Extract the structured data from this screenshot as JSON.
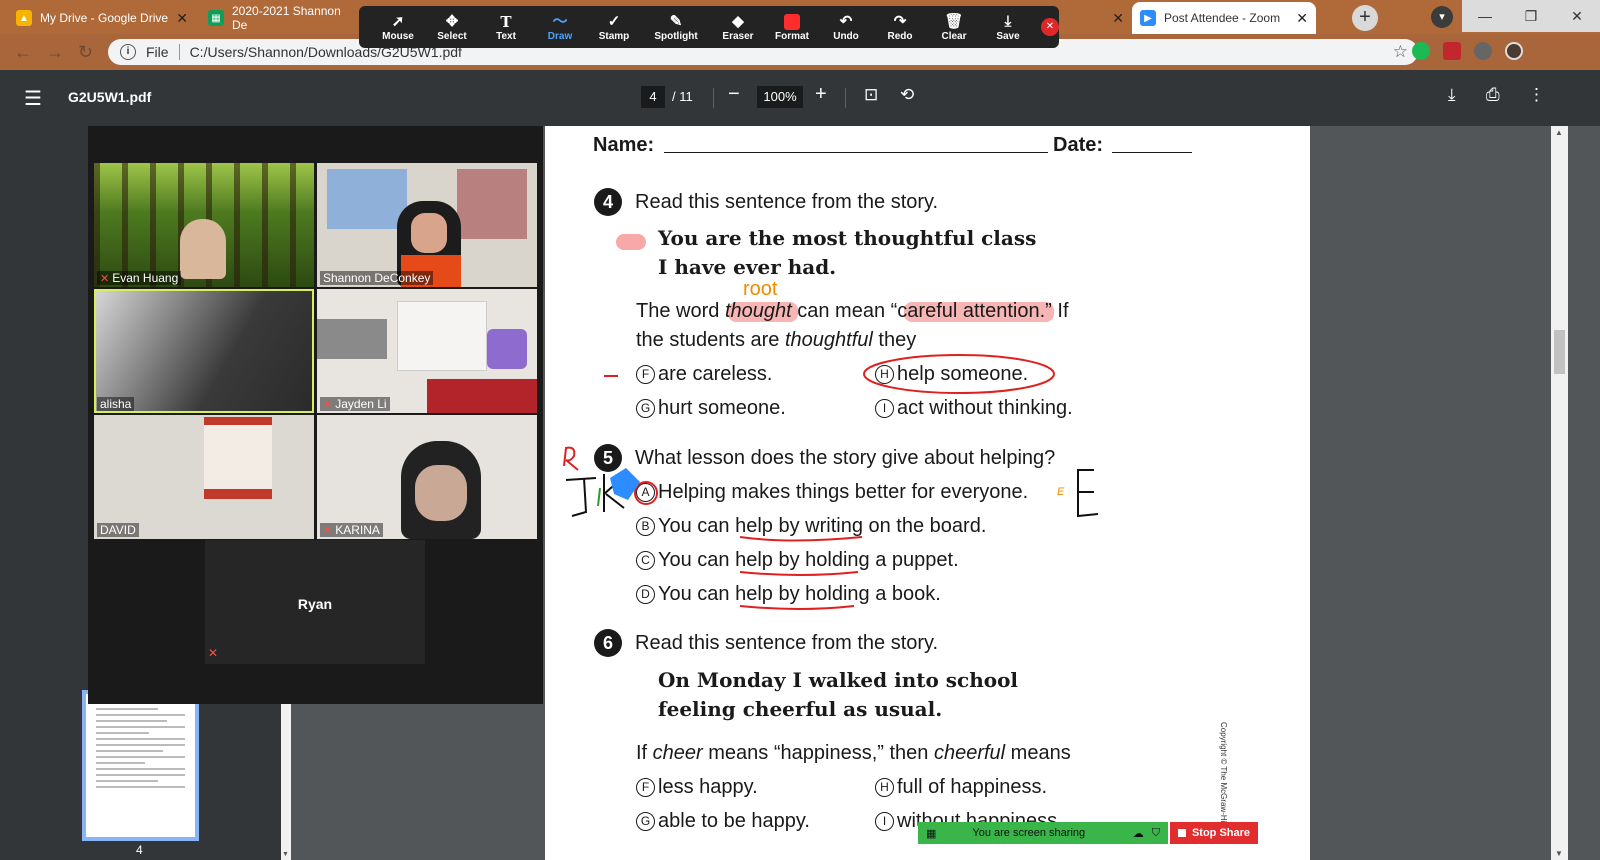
{
  "browser": {
    "tabs": [
      {
        "title": "My Drive - Google Drive",
        "icon": "google-drive-icon"
      },
      {
        "title": "2020-2021 Shannon De",
        "icon": "google-sheets-icon"
      },
      {
        "title": "Post Attendee - Zoom",
        "icon": "zoom-icon"
      }
    ],
    "address": {
      "scheme_label": "File",
      "url": "C:/Users/Shannon/Downloads/G2U5W1.pdf"
    },
    "colors": {
      "frame": "#b06a3a"
    }
  },
  "zoom_toolbar": {
    "tools": [
      {
        "label": "Mouse",
        "icon": "cursor-icon"
      },
      {
        "label": "Select",
        "icon": "move-icon"
      },
      {
        "label": "Text",
        "icon": "text-icon"
      },
      {
        "label": "Draw",
        "icon": "squiggle-icon"
      },
      {
        "label": "Stamp",
        "icon": "checkmark-icon"
      },
      {
        "label": "Spotlight",
        "icon": "wand-icon"
      },
      {
        "label": "Eraser",
        "icon": "eraser-icon"
      },
      {
        "label": "Format",
        "icon": "color-swatch-icon"
      },
      {
        "label": "Undo",
        "icon": "undo-icon"
      },
      {
        "label": "Redo",
        "icon": "redo-icon"
      },
      {
        "label": "Clear",
        "icon": "trash-icon"
      },
      {
        "label": "Save",
        "icon": "save-icon"
      }
    ],
    "selected_tool": "Draw",
    "format_color": "#ff2d2d"
  },
  "pdf_viewer": {
    "filename": "G2U5W1.pdf",
    "current_page": "4",
    "total_pages": "/ 11",
    "zoom": "100%",
    "thumbnail_page": "4"
  },
  "worksheet": {
    "name_label": "Name:",
    "date_label": "Date:",
    "q4": {
      "number": "4",
      "prompt": "Read this sentence from the story.",
      "quote_line1": "You are the most thoughtful class",
      "quote_line2": "I have ever had.",
      "stem_line1_a": "The word ",
      "stem_line1_b": "thought",
      "stem_line1_c": " can mean “",
      "stem_line1_d": "careful attention",
      "stem_line1_e": ".” If",
      "stem_line2_a": "the students are ",
      "stem_line2_b": "thoughtful",
      "stem_line2_c": " they",
      "options": [
        {
          "letter": "F",
          "text": "are careless."
        },
        {
          "letter": "H",
          "text": "help someone."
        },
        {
          "letter": "G",
          "text": "hurt someone."
        },
        {
          "letter": "I",
          "text": "act without thinking."
        }
      ]
    },
    "q5": {
      "number": "5",
      "prompt": "What lesson does the story give about helping?",
      "options": [
        {
          "letter": "A",
          "text": "Helping makes things better for everyone."
        },
        {
          "letter": "B",
          "text": "You can help by writing on the board."
        },
        {
          "letter": "C",
          "text": "You can help by holding a puppet."
        },
        {
          "letter": "D",
          "text": "You can help by holding a book."
        }
      ]
    },
    "q6": {
      "number": "6",
      "prompt": "Read this sentence from the story.",
      "quote_line1": "On Monday I walked into school",
      "quote_line2": "feeling cheerful as usual.",
      "stem_a": "If ",
      "stem_b": "cheer",
      "stem_c": " means “happiness,” then ",
      "stem_d": "cheerful",
      "stem_e": " means",
      "options": [
        {
          "letter": "F",
          "text": "less happy."
        },
        {
          "letter": "H",
          "text": "full of happiness."
        },
        {
          "letter": "G",
          "text": "able to be happy."
        },
        {
          "letter": "I",
          "text": "without happiness."
        }
      ]
    },
    "copyright": "Copyright © The McGraw-Hill",
    "annotations": {
      "root_label": "root",
      "e_mark": "E",
      "ink_color": "#e02020",
      "highlight_color": "#f7a8a8",
      "orange": "#f08a00"
    }
  },
  "zoom_meeting": {
    "participants": [
      {
        "name": "Evan Huang",
        "muted": true
      },
      {
        "name": "Shannon DeConkey",
        "muted": false
      },
      {
        "name": "alisha",
        "muted": false,
        "active": true
      },
      {
        "name": "Jayden Li",
        "muted": true
      },
      {
        "name": "DAVID",
        "muted": false
      },
      {
        "name": "KARINA",
        "muted": true
      }
    ],
    "audio_only": {
      "name": "Ryan",
      "muted": true
    },
    "share_status": "You are screen sharing",
    "stop_share_label": "Stop Share",
    "colors": {
      "share_bar": "#3ab54a",
      "stop": "#e12d2d"
    }
  }
}
